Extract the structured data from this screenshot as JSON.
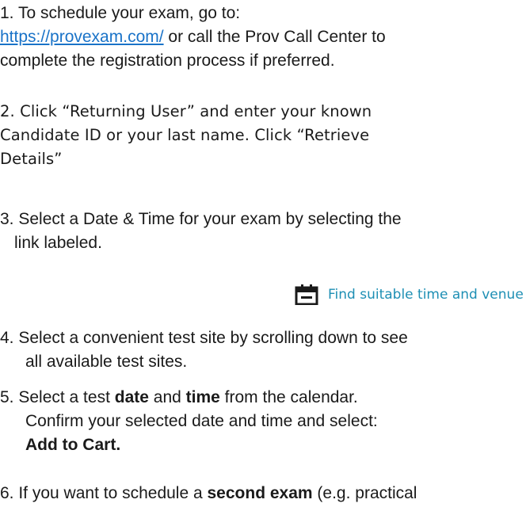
{
  "steps": {
    "s1_text": "1. To schedule your exam, go to:",
    "s1_link": "https://provexam.com/",
    "s1_after": " or call the Prov Call Center to",
    "s1_line2": "complete the registration process if preferred.",
    "s2_line1": "2. Click “Returning User” and enter your known",
    "s2_line2": "Candidate ID or your last name. Click “Retrieve",
    "s2_line3": "Details”",
    "s3_line1": "3. Select a Date & Time for your exam by selecting the",
    "s3_line2": "link labeled.",
    "s3_button": "Find suitable time and venue",
    "s3_button_icon": "calendar-icon",
    "s4_line1": "4. Select a convenient test site by scrolling down to see",
    "s4_line2": "all available test sites.",
    "s5_pre": "5. Select a test ",
    "s5_date": "date",
    "s5_mid": " and ",
    "s5_time": "time",
    "s5_post": " from the calendar.",
    "s5_line2": "Confirm your selected date and time and select:",
    "s5_line3": "Add to Cart.",
    "s6_pre": "6. If you want to schedule a ",
    "s6_bold": "second exam",
    "s6_post": " (e.g. practical"
  },
  "colors": {
    "link": "#1a73c8",
    "button_text": "#1e8fb4",
    "icon": "#1a1a1a"
  }
}
